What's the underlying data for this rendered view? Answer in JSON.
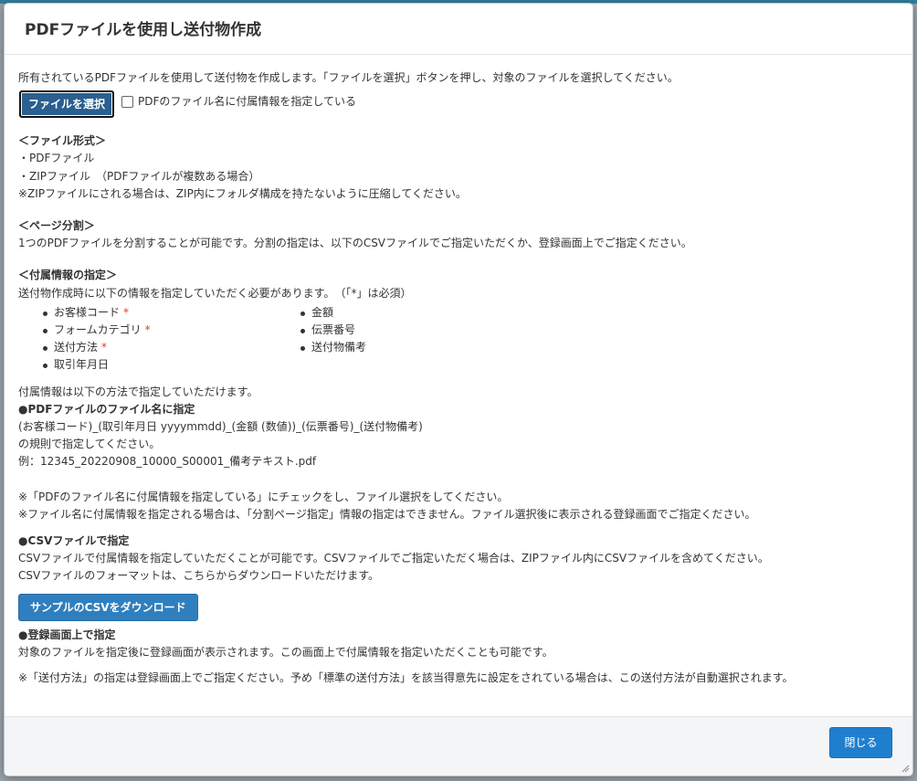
{
  "dialog": {
    "title": "PDFファイルを使用し送付物作成",
    "intro": "所有されているPDFファイルを使用して送付物を作成します。「ファイルを選択」ボタンを押し、対象のファイルを選択してください。",
    "file_button": "ファイルを選択",
    "checkbox_label": "PDFのファイル名に付属情報を指定している",
    "file_format": {
      "heading": "＜ファイル形式＞",
      "lines": [
        "・PDFファイル",
        "・ZIPファイル　（PDFファイルが複数ある場合）",
        "※ZIPファイルにされる場合は、ZIP内にフォルダ構成を持たないように圧縮してください。"
      ]
    },
    "page_split": {
      "heading": "＜ページ分割＞",
      "text": "1つのPDFファイルを分割することが可能です。分割の指定は、以下のCSVファイルでご指定いただくか、登録画面上でご指定ください。"
    },
    "attached_info": {
      "heading": "＜付属情報の指定＞",
      "text": "送付物作成時に以下の情報を指定していただく必要があります。　（「*」は必須）",
      "items": [
        {
          "label": "お客様コード",
          "required": "*"
        },
        {
          "label": "金額",
          "required": ""
        },
        {
          "label": "フォームカテゴリ",
          "required": "*"
        },
        {
          "label": "伝票番号",
          "required": ""
        },
        {
          "label": "送付方法",
          "required": "*"
        },
        {
          "label": "送付物備考",
          "required": ""
        },
        {
          "label": "取引年月日",
          "required": ""
        }
      ],
      "methods_text": "付属情報は以下の方法で指定していただけます。"
    },
    "method_filename": {
      "heading": "●PDFファイルのファイル名に指定",
      "lines": [
        "(お客様コード)_(取引年月日 yyyymmdd)_(金額 (数値))_(伝票番号)_(送付物備考)",
        "の規則で指定してください。",
        "例：12345_20220908_10000_S00001_備考テキスト.pdf"
      ],
      "notes": [
        "※「PDFのファイル名に付属情報を指定している」にチェックをし、ファイル選択をしてください。",
        "※ファイル名に付属情報を指定される場合は、「分割ページ指定」情報の指定はできません。ファイル選択後に表示される登録画面でご指定ください。"
      ]
    },
    "method_csv": {
      "heading": "●CSVファイルで指定",
      "lines": [
        "CSVファイルで付属情報を指定していただくことが可能です。CSVファイルでご指定いただく場合は、ZIPファイル内にCSVファイルを含めてください。",
        "CSVファイルのフォーマットは、こちらからダウンロードいただけます。"
      ],
      "download_button": "サンプルのCSVをダウンロード"
    },
    "method_screen": {
      "heading": "●登録画面上で指定",
      "text": "対象のファイルを指定後に登録画面が表示されます。この画面上で付属情報を指定いただくことも可能です。",
      "note": "※「送付方法」の指定は登録画面上でご指定ください。予め「標準の送付方法」を該当得意先に設定をされている場合は、この送付方法が自動選択されます。"
    },
    "close_button": "閉じる"
  }
}
